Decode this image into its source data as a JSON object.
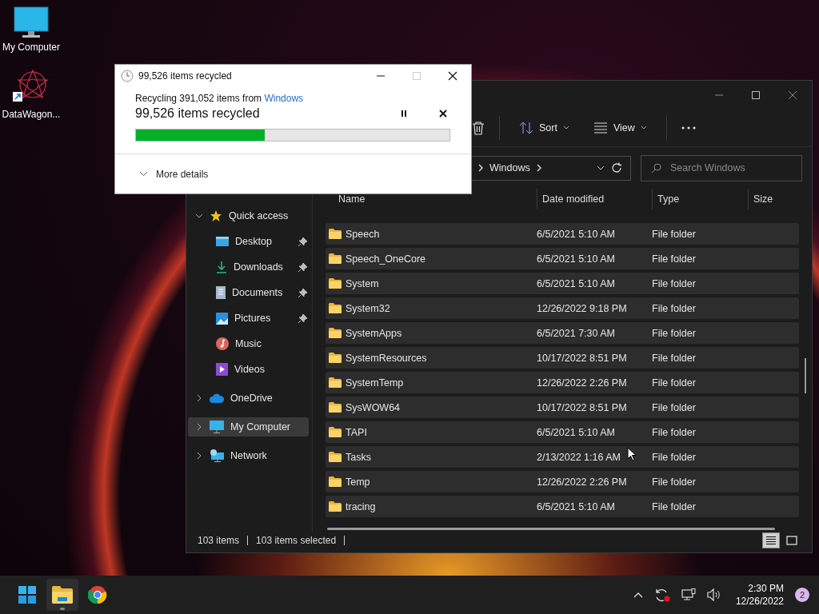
{
  "desktop_icons": [
    {
      "label": "My Computer",
      "kind": "computer"
    },
    {
      "label": "DataWagon...",
      "kind": "shortcut"
    }
  ],
  "dialog": {
    "title": "99,526 items recycled",
    "maximize_disabled": true,
    "message": "Recycling 391,052 items from ",
    "source_link": "Windows",
    "status": "99,526 items recycled",
    "level": 0.41,
    "more_details": "More details"
  },
  "explorer": {
    "toolbar": [
      {
        "label": "Sort",
        "kind": "sort"
      },
      {
        "label": "View",
        "kind": "view"
      }
    ],
    "address": {
      "crumb": "Windows"
    },
    "search": {
      "placeholder": "Search Windows"
    },
    "nav": [
      {
        "label": "Quick access",
        "kind": "star",
        "expanded": true,
        "selected": false,
        "children": [
          {
            "label": "Desktop",
            "kind": "desktop",
            "pinned": true
          },
          {
            "label": "Downloads",
            "kind": "download",
            "pinned": true
          },
          {
            "label": "Documents",
            "kind": "document",
            "pinned": true
          },
          {
            "label": "Pictures",
            "kind": "picture",
            "pinned": true
          },
          {
            "label": "Music",
            "kind": "music",
            "pinned": false
          },
          {
            "label": "Videos",
            "kind": "video",
            "pinned": false
          }
        ]
      },
      {
        "label": "OneDrive",
        "kind": "cloud",
        "expanded": false,
        "selected": false
      },
      {
        "label": "My Computer",
        "kind": "computer",
        "expanded": false,
        "selected": true
      },
      {
        "label": "Network",
        "kind": "network",
        "expanded": false,
        "selected": false
      }
    ],
    "columns": [
      "Name",
      "Date modified",
      "Type",
      "Size"
    ],
    "rows": [
      {
        "name": "Speech",
        "date": "6/5/2021 5:10 AM",
        "type": "File folder",
        "selected": true
      },
      {
        "name": "Speech_OneCore",
        "date": "6/5/2021 5:10 AM",
        "type": "File folder",
        "selected": true
      },
      {
        "name": "System",
        "date": "6/5/2021 5:10 AM",
        "type": "File folder",
        "selected": true
      },
      {
        "name": "System32",
        "date": "12/26/2022 9:18 PM",
        "type": "File folder",
        "selected": true
      },
      {
        "name": "SystemApps",
        "date": "6/5/2021 7:30 AM",
        "type": "File folder",
        "selected": true
      },
      {
        "name": "SystemResources",
        "date": "10/17/2022 8:51 PM",
        "type": "File folder",
        "selected": true
      },
      {
        "name": "SystemTemp",
        "date": "12/26/2022 2:26 PM",
        "type": "File folder",
        "selected": true
      },
      {
        "name": "SysWOW64",
        "date": "10/17/2022 8:51 PM",
        "type": "File folder",
        "selected": true
      },
      {
        "name": "TAPI",
        "date": "6/5/2021 5:10 AM",
        "type": "File folder",
        "selected": true
      },
      {
        "name": "Tasks",
        "date": "2/13/2022 1:16 AM",
        "type": "File folder",
        "selected": true
      },
      {
        "name": "Temp",
        "date": "12/26/2022 2:26 PM",
        "type": "File folder",
        "selected": true
      },
      {
        "name": "tracing",
        "date": "6/5/2021 5:10 AM",
        "type": "File folder",
        "selected": true
      }
    ],
    "status_bar": {
      "item_count": "103 items",
      "selection": "103 items selected"
    },
    "view_buttons": [
      {
        "kind": "details",
        "selected": true
      },
      {
        "kind": "tiles",
        "selected": false
      }
    ]
  },
  "taskbar": {
    "apps": [
      {
        "kind": "start",
        "active": false
      },
      {
        "kind": "explorer",
        "active": true
      },
      {
        "kind": "chrome",
        "active": false
      }
    ],
    "time": "2:30 PM",
    "date": "12/26/2022",
    "notification_count": "2"
  }
}
